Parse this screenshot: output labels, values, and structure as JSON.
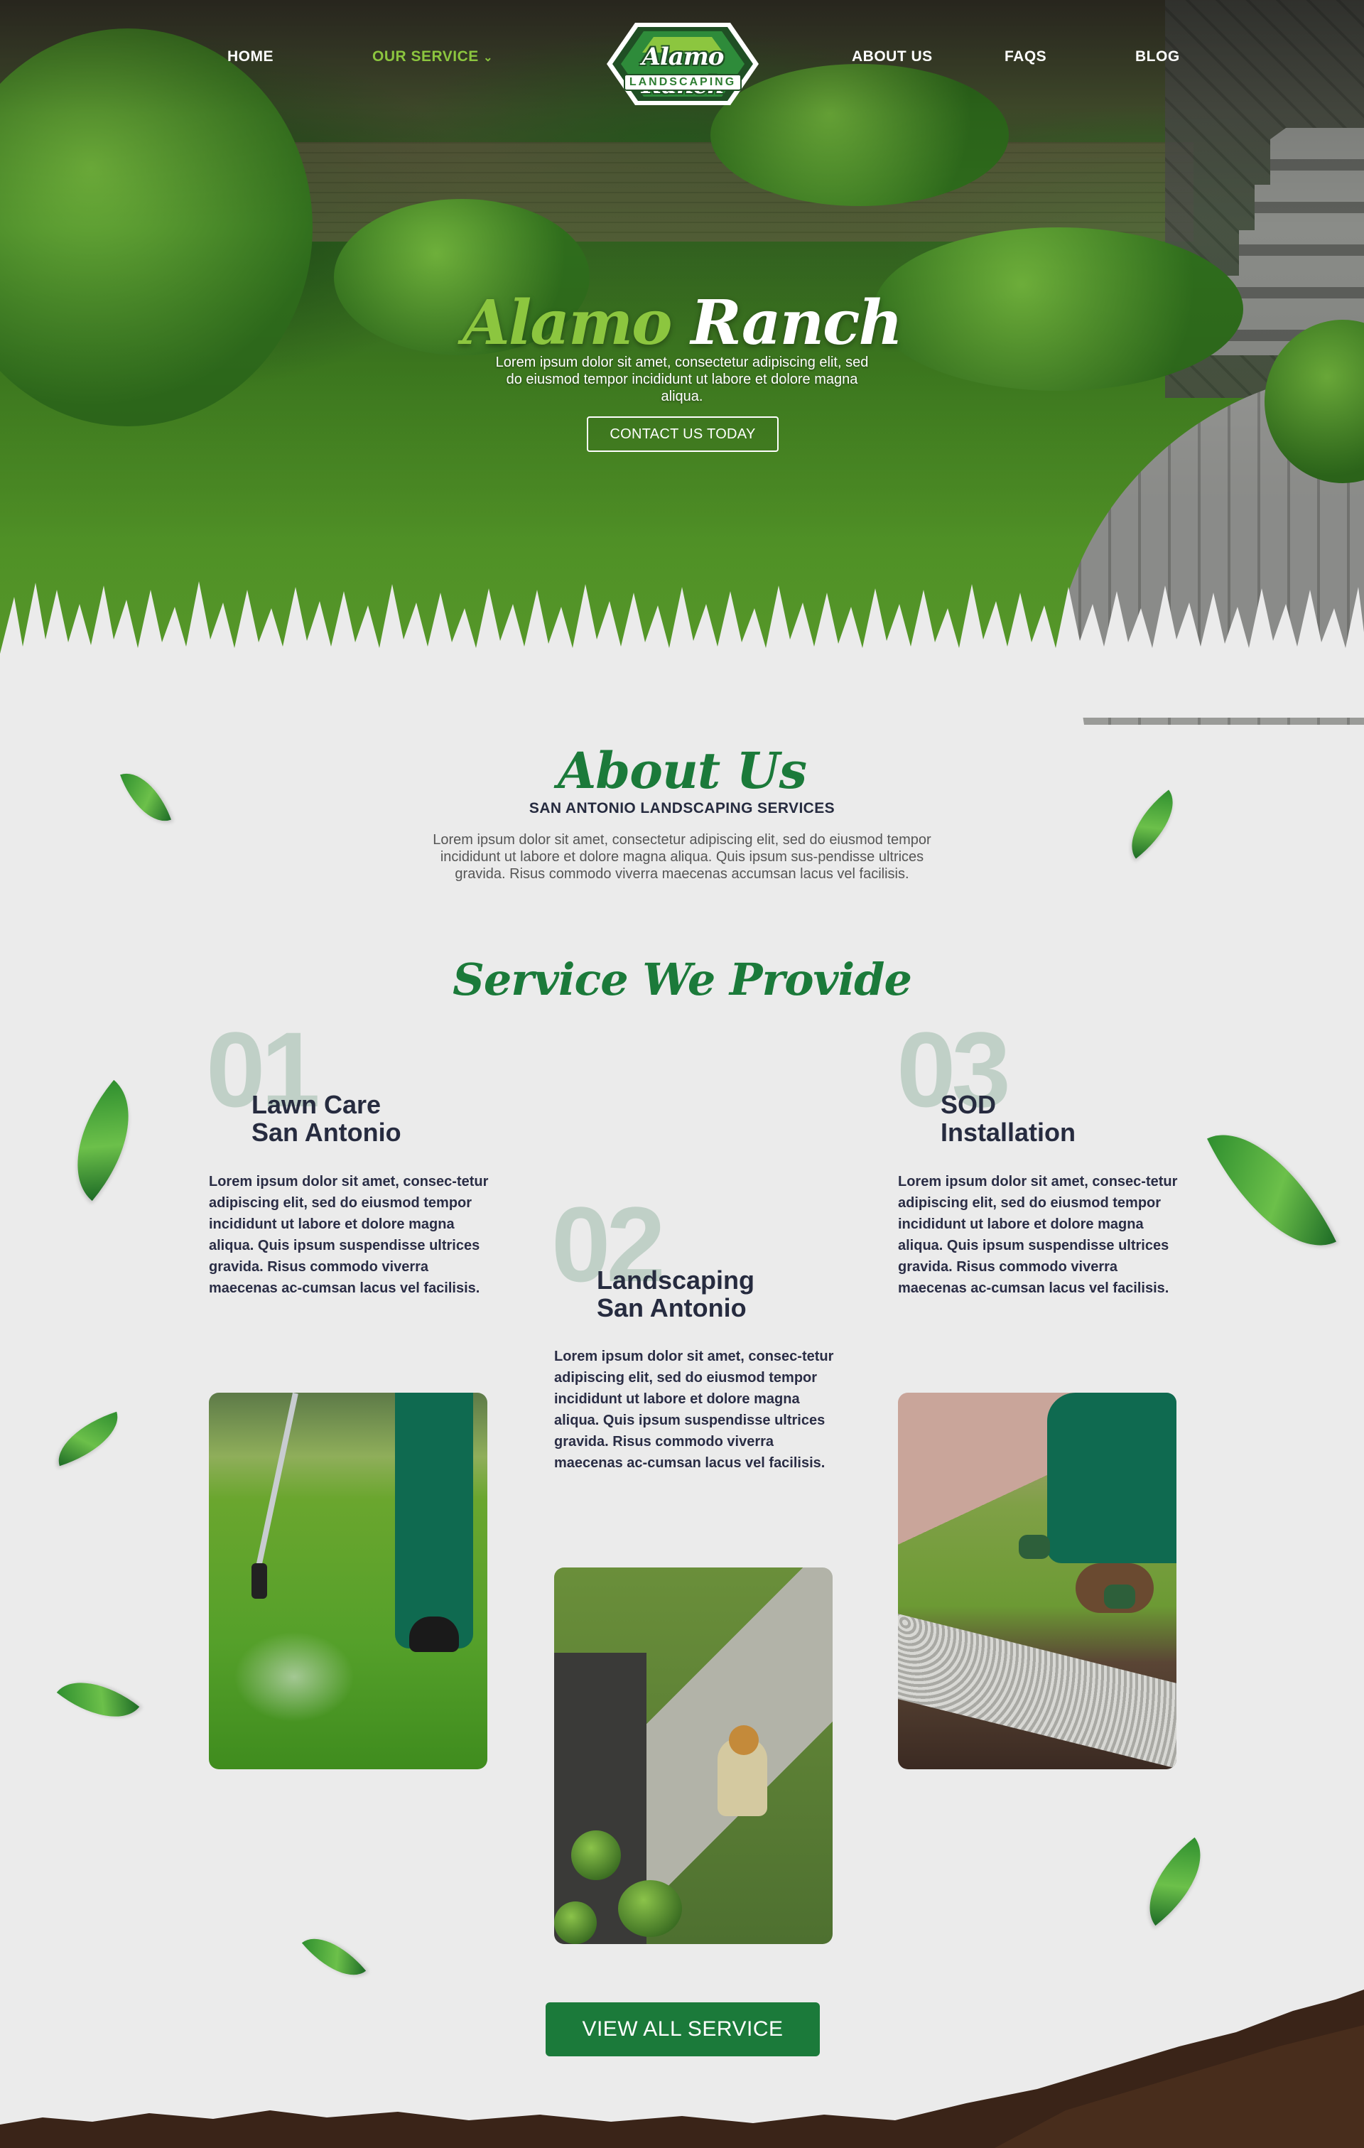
{
  "nav": {
    "home": "HOME",
    "services": "OUR SERVICE",
    "services_caret": "⌄",
    "about": "ABOUT US",
    "faqs": "FAQS",
    "blog": "BLOG"
  },
  "logo": {
    "name": "Alamo Ranch",
    "tagline": "LANDSCAPING"
  },
  "hero": {
    "title_part1": "Alamo",
    "title_part2": "Ranch",
    "description": "Lorem ipsum dolor sit amet, consectetur adipiscing elit, sed do eiusmod tempor incididunt ut labore et dolore magna aliqua.",
    "cta": "CONTACT US TODAY"
  },
  "about": {
    "title": "About Us",
    "subtitle": "SAN ANTONIO LANDSCAPING SERVICES",
    "description": "Lorem ipsum dolor sit amet, consectetur adipiscing elit, sed do eiusmod tempor incididunt ut labore et dolore magna aliqua. Quis ipsum sus-pendisse ultrices gravida. Risus commodo viverra maecenas accumsan lacus vel facilisis."
  },
  "services": {
    "title": "Service We Provide",
    "items": [
      {
        "number": "01",
        "title_line1": "Lawn Care",
        "title_line2": "San Antonio",
        "description": "Lorem ipsum dolor sit amet, consec-tetur adipiscing elit, sed do eiusmod tempor incididunt ut labore et dolore magna aliqua. Quis ipsum suspendisse ultrices gravida. Risus commodo viverra maecenas ac-cumsan lacus vel facilisis."
      },
      {
        "number": "02",
        "title_line1": "Landscaping",
        "title_line2": "San Antonio",
        "description": "Lorem ipsum dolor sit amet, consec-tetur adipiscing elit, sed do eiusmod tempor incididunt ut labore et dolore magna aliqua. Quis ipsum suspendisse ultrices gravida. Risus commodo viverra maecenas ac-cumsan lacus vel facilisis."
      },
      {
        "number": "03",
        "title_line1": "SOD",
        "title_line2": "Installation",
        "description": "Lorem ipsum dolor sit amet, consec-tetur adipiscing elit, sed do eiusmod tempor incididunt ut labore et dolore magna aliqua. Quis ipsum suspendisse ultrices gravida. Risus commodo viverra maecenas ac-cumsan lacus vel facilisis."
      }
    ],
    "view_all": "VIEW ALL SERVICE"
  },
  "colors": {
    "brand_green": "#1b7a3a",
    "accent_lime": "#8cc63f",
    "heading_navy": "#262b3f",
    "page_bg": "#ebebeb"
  }
}
